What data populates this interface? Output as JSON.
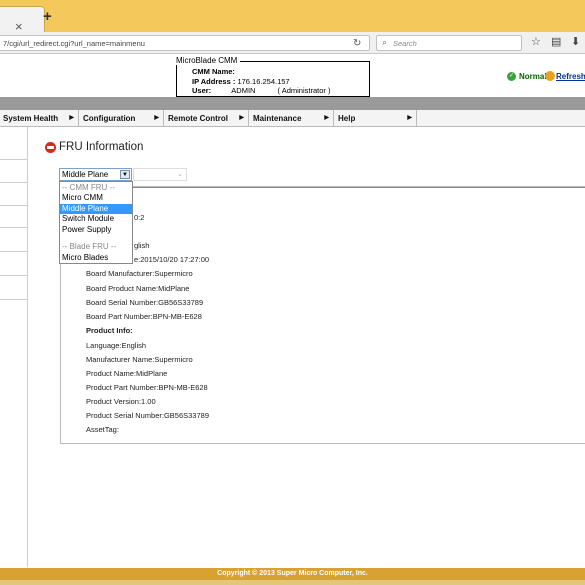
{
  "browser": {
    "url": "7/cgi/url_redirect.cgi?url_name=mainmenu",
    "search_placeholder": "Search",
    "tab_close": "×",
    "new_tab": "+"
  },
  "header": {
    "box_title": "MicroBlade CMM",
    "cmm_name_label": "CMM Name:",
    "cmm_name_value": "",
    "ip_label": "IP Address :",
    "ip_value": "176.16.254.157",
    "user_label": "User:",
    "user_value": "ADMIN",
    "user_role": "( Administrator )",
    "status": "Normal",
    "refresh": "Refresh"
  },
  "menu": {
    "items": [
      {
        "label": "System Health"
      },
      {
        "label": "Configuration"
      },
      {
        "label": "Remote Control"
      },
      {
        "label": "Maintenance"
      },
      {
        "label": "Help"
      }
    ]
  },
  "content": {
    "title": "FRU Information",
    "select_value": "Middle Plane",
    "dropdown": [
      {
        "label": "-- CMM FRU --"
      },
      {
        "label": "Micro CMM"
      },
      {
        "label": "Middle Plane"
      },
      {
        "label": "Switch Module"
      },
      {
        "label": "Power Supply"
      },
      {
        "label": ""
      },
      {
        "label": "-- Blade FRU --"
      },
      {
        "label": "Micro Blades"
      }
    ],
    "partial_fragment_1": "0:2",
    "partial_fragment_2": "glish",
    "mfg_date_fragment": "e:2015/10/20 17:27:00",
    "lines": [
      {
        "text": "Board Manufacturer:Supermicro"
      },
      {
        "text": "Board Product Name:MidPlane"
      },
      {
        "text": "Board Serial Number:GB56S33789"
      },
      {
        "text": "Board Part Number:BPN-MB-E628"
      },
      {
        "text": "Product Info:"
      },
      {
        "text": "Language:English"
      },
      {
        "text": "Manufacturer Name:Supermicro"
      },
      {
        "text": "Product Name:MidPlane"
      },
      {
        "text": "Product Part Number:BPN-MB-E628"
      },
      {
        "text": "Product Version:1.00"
      },
      {
        "text": "Product Serial Number:GB56S33789"
      },
      {
        "text": "AssetTag:"
      }
    ]
  },
  "footer": {
    "text": "Copyright © 2013 Super Micro Computer, Inc."
  }
}
